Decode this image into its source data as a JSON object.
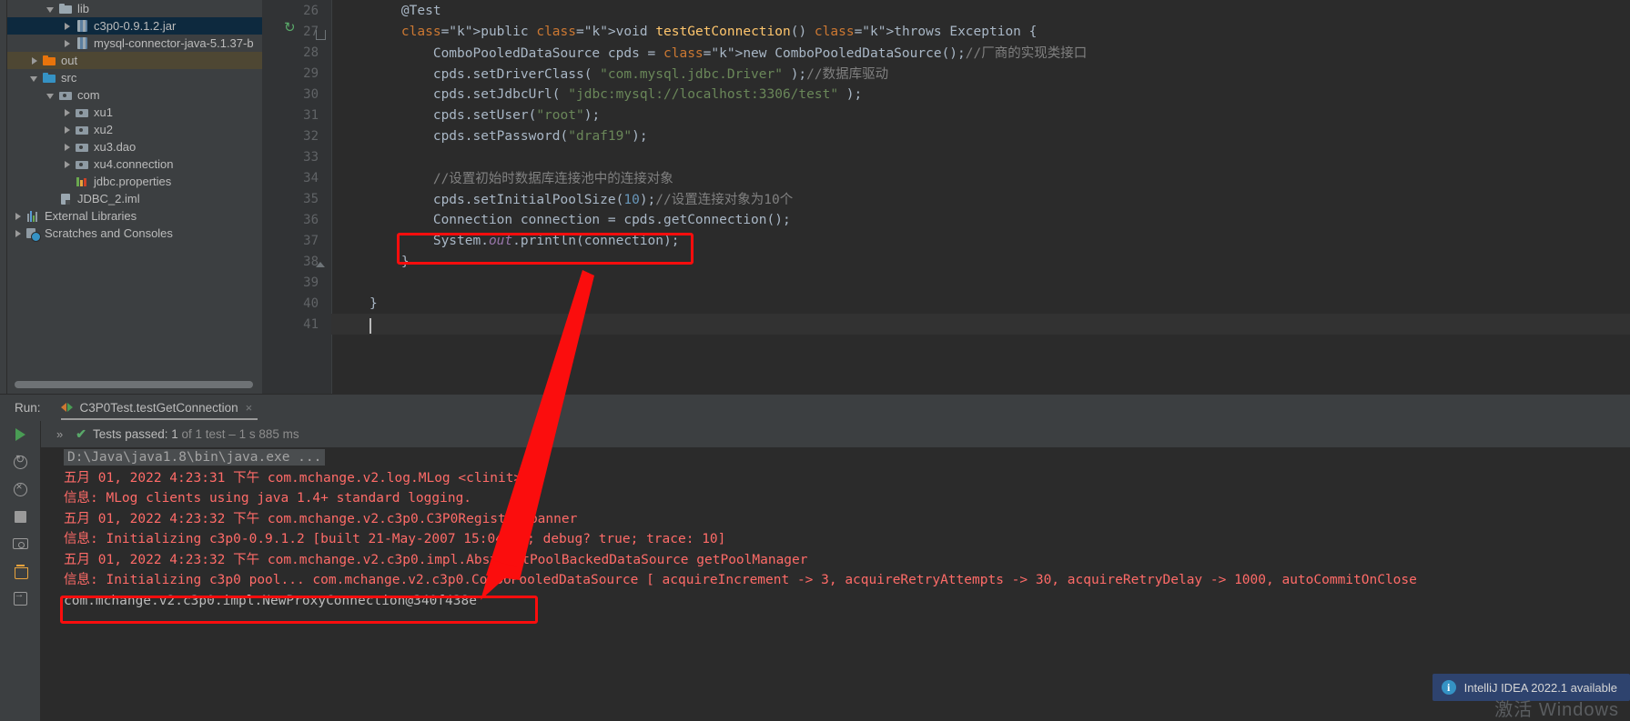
{
  "project_tree": {
    "items": [
      {
        "label": "lib",
        "indent": 2,
        "arrow": "open",
        "icon": "folder-icon",
        "state": "normal"
      },
      {
        "label": "c3p0-0.9.1.2.jar",
        "indent": 3,
        "arrow": "closed",
        "icon": "jar-icon",
        "state": "selected"
      },
      {
        "label": "mysql-connector-java-5.1.37-b",
        "indent": 3,
        "arrow": "closed",
        "icon": "jar-icon",
        "state": "normal"
      },
      {
        "label": "out",
        "indent": 1,
        "arrow": "closed",
        "icon": "folder-orange-icon",
        "state": "highlight"
      },
      {
        "label": "src",
        "indent": 1,
        "arrow": "open",
        "icon": "folder-blue-icon",
        "state": "normal"
      },
      {
        "label": "com",
        "indent": 2,
        "arrow": "open",
        "icon": "package-icon",
        "state": "normal"
      },
      {
        "label": "xu1",
        "indent": 3,
        "arrow": "closed",
        "icon": "package-icon",
        "state": "normal"
      },
      {
        "label": "xu2",
        "indent": 3,
        "arrow": "closed",
        "icon": "package-icon",
        "state": "normal"
      },
      {
        "label": "xu3.dao",
        "indent": 3,
        "arrow": "closed",
        "icon": "package-icon",
        "state": "normal"
      },
      {
        "label": "xu4.connection",
        "indent": 3,
        "arrow": "closed",
        "icon": "package-icon",
        "state": "normal"
      },
      {
        "label": "jdbc.properties",
        "indent": 3,
        "arrow": "none",
        "icon": "properties-file-icon",
        "state": "normal"
      },
      {
        "label": "JDBC_2.iml",
        "indent": 2,
        "arrow": "none",
        "icon": "iml-file-icon",
        "state": "normal"
      },
      {
        "label": "External Libraries",
        "indent": 0,
        "arrow": "closed",
        "icon": "libraries-icon",
        "state": "normal"
      },
      {
        "label": "Scratches and Consoles",
        "indent": 0,
        "arrow": "closed",
        "icon": "scratches-icon",
        "state": "normal"
      }
    ]
  },
  "editor": {
    "lines": [
      {
        "num": "26",
        "text": "    @Test"
      },
      {
        "num": "27",
        "text": "    public void testGetConnection() throws Exception {"
      },
      {
        "num": "28",
        "text": "        ComboPooledDataSource cpds = new ComboPooledDataSource();//厂商的实现类接口"
      },
      {
        "num": "29",
        "text": "        cpds.setDriverClass( \"com.mysql.jdbc.Driver\" );//数据库驱动"
      },
      {
        "num": "30",
        "text": "        cpds.setJdbcUrl( \"jdbc:mysql://localhost:3306/test\" );"
      },
      {
        "num": "31",
        "text": "        cpds.setUser(\"root\");"
      },
      {
        "num": "32",
        "text": "        cpds.setPassword(\"draf19\");"
      },
      {
        "num": "33",
        "text": ""
      },
      {
        "num": "34",
        "text": "        //设置初始时数据库连接池中的连接对象"
      },
      {
        "num": "35",
        "text": "        cpds.setInitialPoolSize(10);//设置连接对象为10个"
      },
      {
        "num": "36",
        "text": "        Connection connection = cpds.getConnection();"
      },
      {
        "num": "37",
        "text": "        System.out.println(connection);"
      },
      {
        "num": "38",
        "text": "    }"
      },
      {
        "num": "39",
        "text": ""
      },
      {
        "num": "40",
        "text": "}"
      },
      {
        "num": "41",
        "text": ""
      }
    ]
  },
  "run_panel": {
    "run_label": "Run:",
    "tab_label": "C3P0Test.testGetConnection",
    "close_label": "×",
    "expand_chevron": "»",
    "check_glyph": "✔",
    "test_result_prefix": "Tests passed: 1",
    "test_result_suffix": " of 1 test – 1 s 885 ms",
    "console": [
      {
        "type": "cmd",
        "text": "D:\\Java\\java1.8\\bin\\java.exe ..."
      },
      {
        "type": "err",
        "text": "五月 01, 2022 4:23:31 下午 com.mchange.v2.log.MLog <clinit>"
      },
      {
        "type": "err",
        "text": "信息: MLog clients using java 1.4+ standard logging."
      },
      {
        "type": "err",
        "text": "五月 01, 2022 4:23:32 下午 com.mchange.v2.c3p0.C3P0Registry banner"
      },
      {
        "type": "err",
        "text": "信息: Initializing c3p0-0.9.1.2 [built 21-May-2007 15:04:56; debug? true; trace: 10]"
      },
      {
        "type": "err",
        "text": "五月 01, 2022 4:23:32 下午 com.mchange.v2.c3p0.impl.AbstractPoolBackedDataSource getPoolManager"
      },
      {
        "type": "err",
        "text": "信息: Initializing c3p0 pool... com.mchange.v2.c3p0.ComboPooledDataSource [ acquireIncrement -> 3, acquireRetryAttempts -> 30, acquireRetryDelay -> 1000, autoCommitOnClose"
      },
      {
        "type": "out",
        "text": "com.mchange.v2.c3p0.impl.NewProxyConnection@340f438e"
      }
    ]
  },
  "notification": {
    "icon_label": "i",
    "text": "IntelliJ IDEA 2022.1 available"
  },
  "watermark": {
    "text": "激活 Windows"
  },
  "colors": {
    "annotation_red": "#fb0d0d",
    "selection_blue": "#0d293e",
    "highlight_tan": "#4e4733",
    "editor_bg": "#2b2b2b",
    "panel_bg": "#3c3f41",
    "console_error": "#ff6b68",
    "test_pass_green": "#59a869"
  }
}
